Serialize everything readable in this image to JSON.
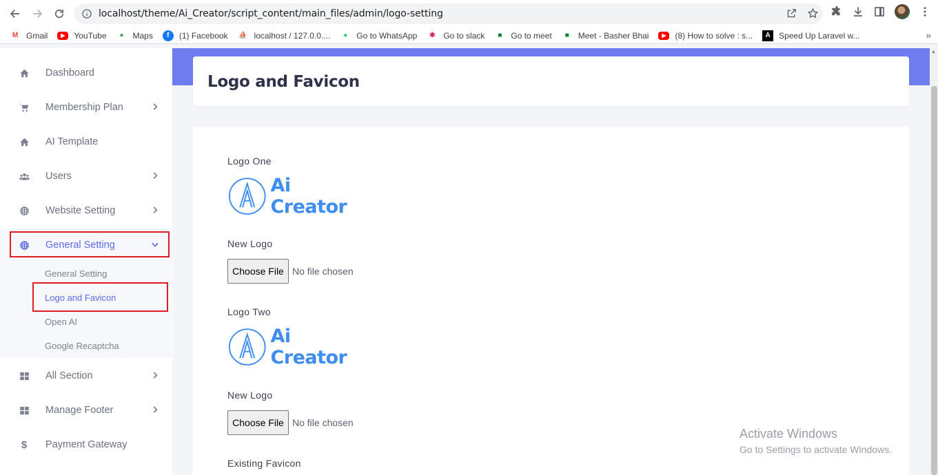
{
  "browser": {
    "url": "localhost/theme/Ai_Creator/script_content/main_files/admin/logo-setting",
    "bookmarks": [
      {
        "label": "Gmail",
        "icon": "gmail-icon",
        "color": "#ea4335"
      },
      {
        "label": "YouTube",
        "icon": "youtube-icon",
        "color": "#ff0000"
      },
      {
        "label": "Maps",
        "icon": "maps-icon",
        "color": "#34a853"
      },
      {
        "label": "(1) Facebook",
        "icon": "facebook-icon",
        "color": "#1877f2"
      },
      {
        "label": "localhost / 127.0.0....",
        "icon": "phpmyadmin-icon",
        "color": "#f29111"
      },
      {
        "label": "Go to WhatsApp",
        "icon": "whatsapp-icon",
        "color": "#25d366"
      },
      {
        "label": "Go to slack",
        "icon": "slack-icon",
        "color": "#e01e5a"
      },
      {
        "label": "Go to meet",
        "icon": "meet-icon",
        "color": "#00832d"
      },
      {
        "label": "Meet - Basher Bhai",
        "icon": "meet-icon",
        "color": "#00832d"
      },
      {
        "label": "(8) How to solve : s...",
        "icon": "youtube-icon",
        "color": "#ff0000"
      },
      {
        "label": "Speed Up Laravel w...",
        "icon": "laravel-icon",
        "color": "#cc2222"
      }
    ]
  },
  "sidebar": {
    "items": [
      {
        "label": "Dashboard",
        "icon": "home-icon"
      },
      {
        "label": "Membership Plan",
        "icon": "cart-icon"
      },
      {
        "label": "AI Template",
        "icon": "home-icon"
      },
      {
        "label": "Users",
        "icon": "users-icon"
      },
      {
        "label": "Website Setting",
        "icon": "globe-icon"
      },
      {
        "label": "General Setting",
        "icon": "globe-icon"
      },
      {
        "label": "All Section",
        "icon": "grid-icon"
      },
      {
        "label": "Manage Footer",
        "icon": "grid-icon"
      },
      {
        "label": "Payment Gateway",
        "icon": "dollar-icon"
      }
    ],
    "subitems": [
      {
        "label": "General Setting"
      },
      {
        "label": "Logo and Favicon"
      },
      {
        "label": "Open AI"
      },
      {
        "label": "Google Recaptcha"
      }
    ]
  },
  "page": {
    "title": "Logo and Favicon",
    "accent": "#6e7cf0",
    "logo_one_label": "Logo One",
    "logo_two_label": "Logo Two",
    "new_logo_label": "New Logo",
    "existing_favicon_label": "Existing Favicon",
    "brand_text": "Ai Creator",
    "choose_file": "Choose File",
    "no_file": "No file chosen"
  },
  "watermark": {
    "line1": "Activate Windows",
    "line2": "Go to Settings to activate Windows."
  }
}
